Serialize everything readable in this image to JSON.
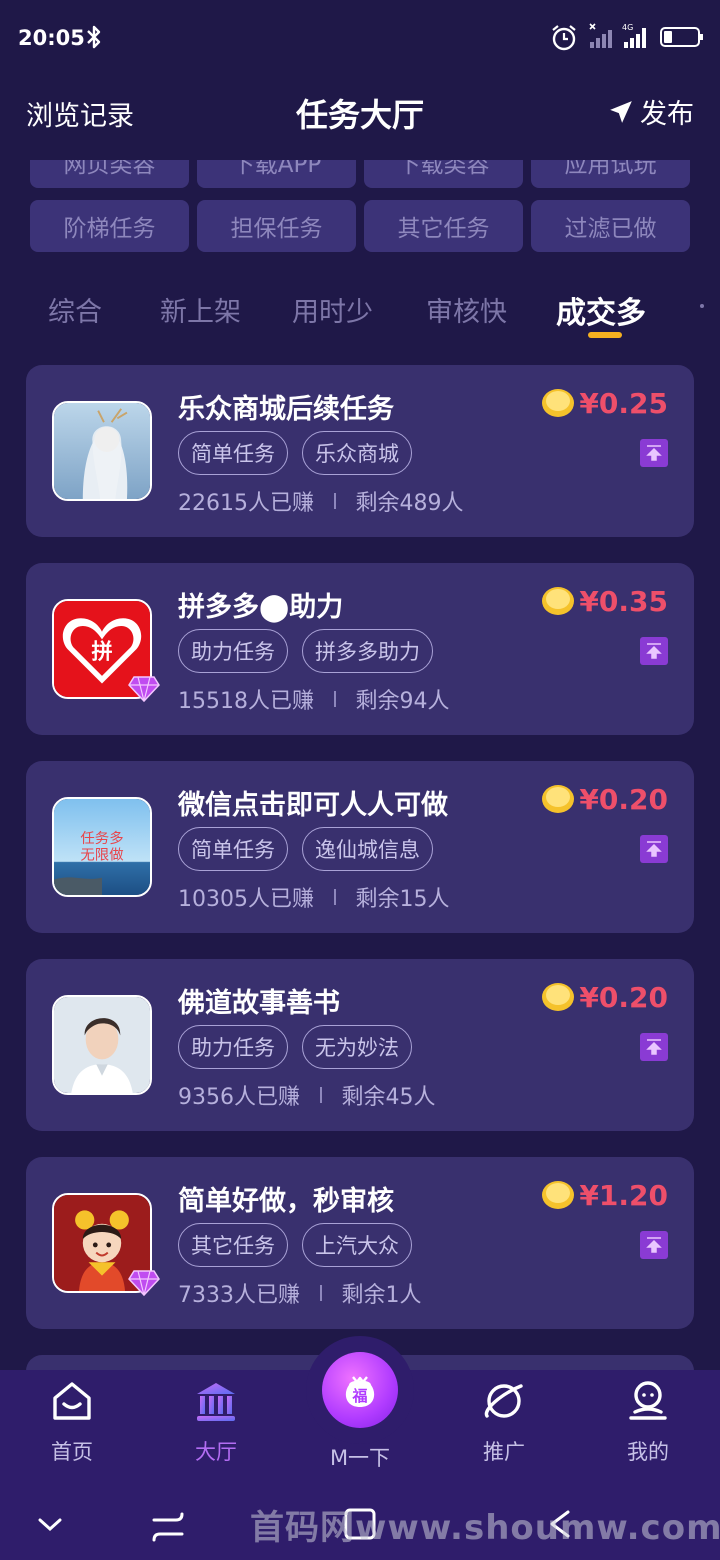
{
  "status_bar": {
    "time": "20:05",
    "network_label": "4G"
  },
  "header": {
    "history_label": "浏览记录",
    "title": "任务大厅",
    "publish_label": "发布"
  },
  "chips": {
    "row0": [
      "网页类容",
      "下载APP",
      "下载类容",
      "应用试玩"
    ],
    "row1": [
      "阶梯任务",
      "担保任务",
      "其它任务",
      "过滤已做"
    ]
  },
  "sort_tabs": [
    "综合",
    "新上架",
    "用时少",
    "审核快",
    "成交多"
  ],
  "active_sort_tab": "成交多",
  "tasks": [
    {
      "title": "乐众商城后续任务",
      "tags": [
        "简单任务",
        "乐众商城"
      ],
      "earned": "22615人已赚",
      "remaining": "剩余489人",
      "price": "¥0.25",
      "avatar": "fantasy-character-avatar",
      "vip": false
    },
    {
      "title": "拼多多⬤助力",
      "tags": [
        "助力任务",
        "拼多多助力"
      ],
      "earned": "15518人已赚",
      "remaining": "剩余94人",
      "price": "¥0.35",
      "avatar": "pinduoduo-logo",
      "vip": true,
      "avatar_text": "拼"
    },
    {
      "title": "微信点击即可人人可做",
      "tags": [
        "简单任务",
        "逸仙城信息"
      ],
      "earned": "10305人已赚",
      "remaining": "剩余15人",
      "price": "¥0.20",
      "avatar": "sea-landscape-avatar",
      "vip": false,
      "avatar_text": "任务多\n无限做"
    },
    {
      "title": "佛道故事善书",
      "tags": [
        "助力任务",
        "无为妙法"
      ],
      "earned": "9356人已赚",
      "remaining": "剩余45人",
      "price": "¥0.20",
      "avatar": "man-portrait-avatar",
      "vip": false
    },
    {
      "title": "简单好做，秒审核",
      "tags": [
        "其它任务",
        "上汽大众"
      ],
      "earned": "7333人已赚",
      "remaining": "剩余1人",
      "price": "¥1.20",
      "avatar": "cartoon-boy-avatar",
      "vip": true
    }
  ],
  "bottom_nav": {
    "items": [
      {
        "label": "首页",
        "icon": "home-icon"
      },
      {
        "label": "大厅",
        "icon": "hall-icon"
      },
      {
        "label": "M一下",
        "icon": "fu-bag-icon"
      },
      {
        "label": "推广",
        "icon": "planet-icon"
      },
      {
        "label": "我的",
        "icon": "profile-icon"
      }
    ],
    "active": "大厅",
    "center_glyph": "福"
  },
  "watermark": "首码网www.shoumw.com",
  "colors": {
    "background": "#1f1848",
    "card": "#39306e",
    "price": "#ee4f6a",
    "accent": "#b36df3",
    "tab_underline": "#f5b020"
  }
}
